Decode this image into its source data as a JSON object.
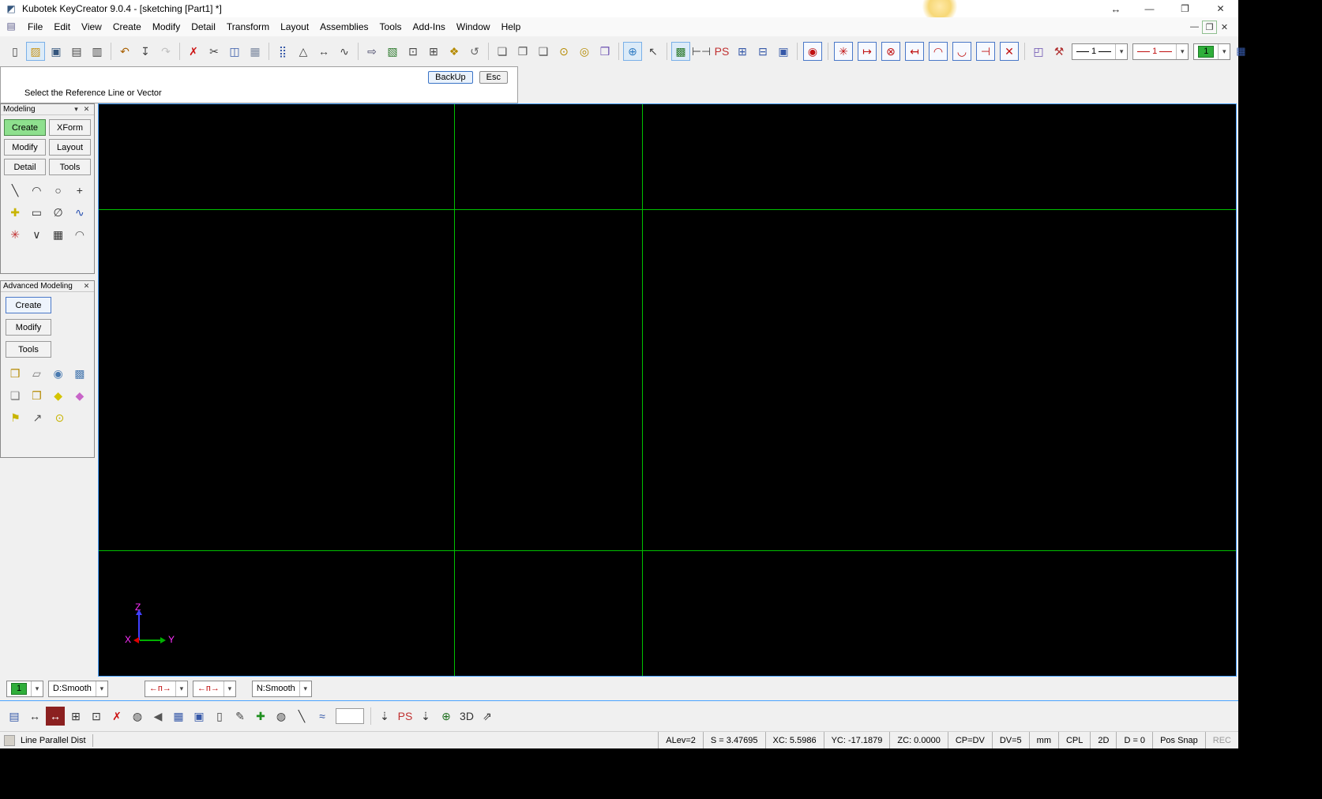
{
  "colors": {
    "grid_green": "#00c000",
    "viewport_border_blue": "#4aa3ff",
    "axis_z_blue": "#4040ff",
    "axis_y_green": "#00b000",
    "axis_x_red": "#e00000",
    "axis_label_magenta": "#ff30ff",
    "create_button_green": "#8ee08e",
    "level_swatch_green": "#2fae3a"
  },
  "titlebar": {
    "title": "Kubotek KeyCreator 9.0.4 - [sketching [Part1] *]",
    "resize_glyph": "↔",
    "minimize_glyph": "—",
    "maximize_glyph": "❐",
    "close_glyph": "✕"
  },
  "menubar": {
    "items": [
      "File",
      "Edit",
      "View",
      "Create",
      "Modify",
      "Detail",
      "Transform",
      "Layout",
      "Assemblies",
      "Tools",
      "Add-Ins",
      "Window",
      "Help"
    ],
    "child_controls": {
      "minimize": "—",
      "restore": "❐",
      "close": "✕"
    }
  },
  "main_toolbar": {
    "icons": [
      {
        "n": "new-file-icon",
        "g": "▯",
        "c": "#444"
      },
      {
        "n": "open-file-icon",
        "g": "▨",
        "c": "#c99416",
        "sel": true
      },
      {
        "n": "save-icon",
        "g": "▣",
        "c": "#35567d"
      },
      {
        "n": "print-icon",
        "g": "▤",
        "c": "#444"
      },
      {
        "n": "print-preview-icon",
        "g": "▥",
        "c": "#444"
      },
      {
        "sep": true
      },
      {
        "n": "undo-icon",
        "g": "↶",
        "c": "#a85f00"
      },
      {
        "n": "download-icon",
        "g": "↧",
        "c": "#444"
      },
      {
        "n": "redo-icon",
        "g": "↷",
        "c": "#888",
        "dis": true
      },
      {
        "sep": true
      },
      {
        "n": "delete-icon",
        "g": "✗",
        "c": "#cc1111"
      },
      {
        "n": "cut-icon",
        "g": "✂",
        "c": "#444"
      },
      {
        "n": "copy-icon",
        "g": "◫",
        "c": "#3558a8"
      },
      {
        "n": "paste-icon",
        "g": "▦",
        "c": "#7d8aa0"
      },
      {
        "sep": true
      },
      {
        "n": "array-pattern-icon",
        "g": "⣿",
        "c": "#3558a8"
      },
      {
        "n": "delta-move-icon",
        "g": "△",
        "c": "#444"
      },
      {
        "n": "stretch-icon",
        "g": "↔",
        "c": "#444"
      },
      {
        "n": "spring-stretch-icon",
        "g": "∿",
        "c": "#444"
      },
      {
        "sep": true
      },
      {
        "n": "entity-export-icon",
        "g": "⇨",
        "c": "#446"
      },
      {
        "n": "raster-image-icon",
        "g": "▧",
        "c": "#2d7a2d"
      },
      {
        "n": "fit-view-icon",
        "g": "⊡",
        "c": "#444"
      },
      {
        "n": "zoom-window-icon",
        "g": "⊞",
        "c": "#444"
      },
      {
        "n": "pan-hand-icon",
        "g": "❖",
        "c": "#b58a00"
      },
      {
        "n": "rotate-view-icon",
        "g": "↺",
        "c": "#666"
      },
      {
        "sep": true
      },
      {
        "n": "view-cube-iso-icon",
        "g": "❏",
        "c": "#555"
      },
      {
        "n": "view-cube-front-icon",
        "g": "❐",
        "c": "#555"
      },
      {
        "n": "view-cube-top-icon",
        "g": "❑",
        "c": "#555"
      },
      {
        "n": "solid-cylinder-icon",
        "g": "⊙",
        "c": "#b58a00"
      },
      {
        "n": "solid-cylinder2-icon",
        "g": "◎",
        "c": "#b58a00"
      },
      {
        "n": "material-book-icon",
        "g": "❒",
        "c": "#6a4fb0"
      },
      {
        "sep": true
      },
      {
        "n": "wcs-globe-icon",
        "g": "⊕",
        "c": "#2d7ac2",
        "sel": true
      },
      {
        "n": "select-cursor-icon",
        "g": "↖",
        "c": "#444"
      },
      {
        "sep": true
      },
      {
        "n": "verify-image-icon",
        "g": "▩",
        "c": "#2d7a2d",
        "sel": true
      },
      {
        "n": "measure-ruler-icon",
        "g": "⊢⊣",
        "c": "#444"
      },
      {
        "n": "ps-vue-icon",
        "g": "PS",
        "c": "#c03030"
      },
      {
        "n": "layout-grid-icon",
        "g": "⊞",
        "c": "#3558a8"
      },
      {
        "n": "layout-grid2-icon",
        "g": "⊟",
        "c": "#3558a8"
      },
      {
        "n": "display-monitor-icon",
        "g": "▣",
        "c": "#3558a8"
      },
      {
        "sep": true
      },
      {
        "n": "zoom-target-icon",
        "g": "◉",
        "c": "#c01010",
        "brd": true
      },
      {
        "sep": true
      },
      {
        "n": "snap-point-icon",
        "g": "✳",
        "c": "#c01010",
        "brd": true
      },
      {
        "n": "snap-end-left-icon",
        "g": "↦",
        "c": "#c01010",
        "brd": true
      },
      {
        "n": "snap-center-icon",
        "g": "⊗",
        "c": "#c01010",
        "brd": true
      },
      {
        "n": "snap-end-right-icon",
        "g": "↤",
        "c": "#c01010",
        "brd": true
      },
      {
        "n": "snap-arc-icon",
        "g": "◠",
        "c": "#c01010",
        "brd": true
      },
      {
        "n": "snap-tangent-icon",
        "g": "◡",
        "c": "#c01010",
        "brd": true
      },
      {
        "n": "snap-perp-icon",
        "g": "⊣",
        "c": "#c01010",
        "brd": true
      },
      {
        "n": "snap-intersect-icon",
        "g": "✕",
        "c": "#c01010",
        "brd": true
      },
      {
        "sep": true
      },
      {
        "n": "view-3d-box-icon",
        "g": "◰",
        "c": "#6a4fb0"
      },
      {
        "n": "customize-tools-icon",
        "g": "⚒",
        "c": "#b03030"
      }
    ],
    "line_style_value": "1",
    "line_color_value": "1",
    "level_value": "1",
    "dropdown_glyph": "▾"
  },
  "prompt_bar": {
    "message": "Select the Reference Line or Vector",
    "backup_button": "BackUp",
    "esc_button": "Esc"
  },
  "modeling_panel": {
    "title": "Modeling",
    "dropdown_glyph": "▾",
    "close_glyph": "✕",
    "buttons": [
      "Create",
      "XForm",
      "Modify",
      "Layout",
      "Detail",
      "Tools"
    ],
    "icons_row1": [
      {
        "n": "line-create-icon",
        "g": "╲",
        "c": "#333"
      },
      {
        "n": "arc-create-icon",
        "g": "◠",
        "c": "#333"
      },
      {
        "n": "circle-create-icon",
        "g": "○",
        "c": "#333"
      },
      {
        "n": "point-create-icon",
        "g": "+",
        "c": "#333"
      }
    ],
    "icons_row2": [
      {
        "n": "point-plus-icon",
        "g": "✚",
        "c": "#c8b400"
      },
      {
        "n": "rectangle-create-icon",
        "g": "▭",
        "c": "#333"
      },
      {
        "n": "conic-create-icon",
        "g": "∅",
        "c": "#333"
      },
      {
        "n": "spline-create-icon",
        "g": "∿",
        "c": "#2850b0"
      }
    ],
    "icons_row3": [
      {
        "n": "multi-line-icon",
        "g": "✳",
        "c": "#c03030"
      },
      {
        "n": "chamfer-icon",
        "g": "∨",
        "c": "#333"
      },
      {
        "n": "table-icon",
        "g": "▦",
        "c": "#333"
      },
      {
        "n": "fillet-icon",
        "g": "◠",
        "c": "#555"
      }
    ]
  },
  "advanced_panel": {
    "title": "Advanced Modeling",
    "close_glyph": "✕",
    "buttons": [
      "Create",
      "Modify",
      "Tools"
    ],
    "icons_row1": [
      {
        "n": "solid-block-icon",
        "g": "❒",
        "c": "#b58a00"
      },
      {
        "n": "surface-sweep-icon",
        "g": "▱",
        "c": "#777"
      },
      {
        "n": "mesh-sphere-icon",
        "g": "◉",
        "c": "#4a7ab0"
      },
      {
        "n": "pattern-solid-icon",
        "g": "▩",
        "c": "#4a7ab0"
      }
    ],
    "icons_row2": [
      {
        "n": "blend-solid-icon",
        "g": "❏",
        "c": "#777"
      },
      {
        "n": "block2-icon",
        "g": "❐",
        "c": "#b58a00"
      },
      {
        "n": "prism-yellow-icon",
        "g": "◆",
        "c": "#d4c400"
      },
      {
        "n": "prism-pink-icon",
        "g": "◆",
        "c": "#c864c8"
      }
    ],
    "icons_row3": [
      {
        "n": "flag-icon",
        "g": "⚑",
        "c": "#c8b400"
      },
      {
        "n": "arrow-up-icon",
        "g": "↗",
        "c": "#555"
      },
      {
        "n": "bulb-icon",
        "g": "⊙",
        "c": "#c8b400"
      }
    ]
  },
  "viewport": {
    "axis": {
      "x_label": "X",
      "y_label": "Y",
      "z_label": "Z"
    }
  },
  "bottom_bar": {
    "level_value": "1",
    "depth_combo_value": "D:Smooth",
    "arrow_combo1_glyph": "←п→",
    "arrow_combo2_glyph": "←п→",
    "normal_combo_value": "N:Smooth",
    "dropdown_glyph": "▾"
  },
  "bottom_toolbar": {
    "icons": [
      {
        "n": "form-editor-icon",
        "g": "▤",
        "c": "#3558a8"
      },
      {
        "n": "dim-horizontal-icon",
        "g": "↔",
        "c": "#333"
      },
      {
        "n": "dim-horizontal-active-icon",
        "g": "↔",
        "c": "#fff",
        "bg": "#8b2020"
      },
      {
        "n": "grid-snap-icon",
        "g": "⊞",
        "c": "#333"
      },
      {
        "n": "grid-fit-icon",
        "g": "⊡",
        "c": "#333"
      },
      {
        "n": "delete-entities-icon",
        "g": "✗",
        "c": "#cc1111"
      },
      {
        "n": "shaded-sphere-icon",
        "g": "◍",
        "c": "#3a3a3a"
      },
      {
        "n": "speaker-icon",
        "g": "◀",
        "c": "#555"
      },
      {
        "n": "level-manager-icon",
        "g": "▦",
        "c": "#3558a8"
      },
      {
        "n": "viewport-monitor-icon",
        "g": "▣",
        "c": "#3558a8"
      },
      {
        "n": "new-sketch-icon",
        "g": "▯",
        "c": "#444"
      },
      {
        "n": "annotate-pen-icon",
        "g": "✎",
        "c": "#444"
      },
      {
        "n": "cplane-grid-icon",
        "g": "✚",
        "c": "#1f8f1f"
      },
      {
        "n": "render-sphere-icon",
        "g": "◍",
        "c": "#3a3a3a"
      },
      {
        "n": "line-tool-icon",
        "g": "╲",
        "c": "#333"
      },
      {
        "n": "spline-sketch-icon",
        "g": "≈",
        "c": "#3558a8"
      },
      {
        "field": true
      },
      {
        "sep": true
      },
      {
        "n": "curve-drop-icon",
        "g": "⇣",
        "c": "#333"
      },
      {
        "n": "ps-vue-small-icon",
        "g": "PS",
        "c": "#c03030"
      },
      {
        "n": "curve-c-drop-icon",
        "g": "⇣",
        "c": "#333"
      },
      {
        "n": "mesh-globe-icon",
        "g": "⊕",
        "c": "#1f6f1f"
      },
      {
        "n": "mode-2d3d-icon",
        "g": "3D",
        "c": "#333"
      },
      {
        "n": "curve-z-icon",
        "g": "⇗",
        "c": "#333"
      }
    ]
  },
  "statusbar": {
    "left_mode": "Line Parallel Dist",
    "alev": "ALev=2",
    "scale": "S = 3.47695",
    "xc": "XC: 5.5986",
    "yc": "YC: -17.1879",
    "zc": "ZC: 0.0000",
    "cp": "CP=DV",
    "dv": "DV=5",
    "units": "mm",
    "cpl": "CPL",
    "mode2d": "2D",
    "d": "D = 0",
    "pos_snap": "Pos Snap",
    "rec": "REC"
  }
}
